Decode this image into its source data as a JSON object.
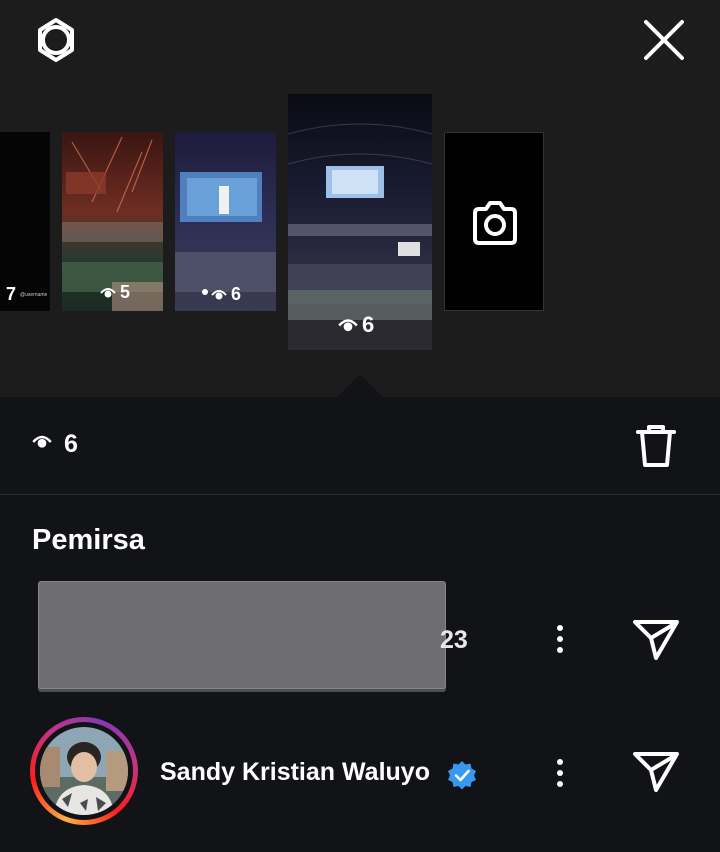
{
  "header": {
    "settings_icon": "gear-icon",
    "close_icon": "close-icon"
  },
  "stories": [
    {
      "views": "7",
      "caption": "@username"
    },
    {
      "views": "5"
    },
    {
      "views": "6"
    },
    {
      "views": "6",
      "selected": true
    }
  ],
  "camera_tile": {
    "icon": "camera-icon"
  },
  "stats": {
    "view_count": "6",
    "delete_icon": "trash-icon"
  },
  "viewers_section": {
    "title": "Pemirsa",
    "viewers": [
      {
        "name_partial": "23",
        "redacted": true
      },
      {
        "name": "Sandy Kristian Waluyo",
        "verified": true
      }
    ]
  },
  "colors": {
    "verified_badge": "#3897f0",
    "background": "#121317",
    "top_background": "#1c1c1c"
  }
}
